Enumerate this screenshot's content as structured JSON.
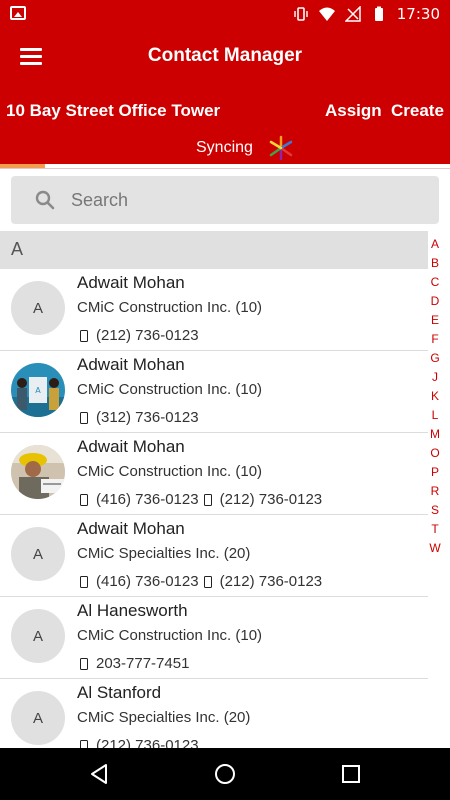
{
  "status_bar": {
    "time": "17:30",
    "icons": [
      "gallery-icon",
      "vibrate-icon",
      "wifi-icon",
      "no-signal-icon",
      "battery-icon"
    ]
  },
  "app_bar": {
    "title": "Contact Manager",
    "menu_icon": "hamburger-menu-icon"
  },
  "sub_bar": {
    "project": "10 Bay Street Office Tower",
    "assign_label": "Assign",
    "create_label": "Create",
    "sync_label": "Syncing",
    "sync_progress": 0.1
  },
  "search": {
    "placeholder": "Search",
    "value": ""
  },
  "section": {
    "letter": "A"
  },
  "alpha_index": [
    "A",
    "B",
    "C",
    "D",
    "E",
    "F",
    "G",
    "J",
    "K",
    "L",
    "M",
    "O",
    "P",
    "R",
    "S",
    "T",
    "W"
  ],
  "contacts": [
    {
      "name": "Adwait Mohan",
      "company": "CMiC Construction Inc. (10)",
      "avatar": "A",
      "phones": [
        "(212) 736-0123"
      ]
    },
    {
      "name": "Adwait Mohan",
      "company": "CMiC Construction Inc. (10)",
      "avatar": "photo",
      "phones": [
        "(312) 736-0123"
      ]
    },
    {
      "name": "Adwait Mohan",
      "company": "CMiC Construction Inc. (10)",
      "avatar": "photo",
      "phones": [
        "(416) 736-0123",
        "(212) 736-0123"
      ]
    },
    {
      "name": "Adwait Mohan",
      "company": "CMiC Specialties Inc. (20)",
      "avatar": "A",
      "phones": [
        "(416) 736-0123",
        "(212) 736-0123"
      ]
    },
    {
      "name": "Al Hanesworth",
      "company": "CMiC Construction Inc. (10)",
      "avatar": "A",
      "phones": [
        "203-777-7451"
      ]
    },
    {
      "name": "Al Stanford",
      "company": "CMiC Specialties Inc. (20)",
      "avatar": "A",
      "phones": [
        "(212) 736-0123"
      ]
    }
  ],
  "colors": {
    "brand_red": "#cc0000",
    "progress": "#f39c4e",
    "index_red": "#cc0000"
  }
}
